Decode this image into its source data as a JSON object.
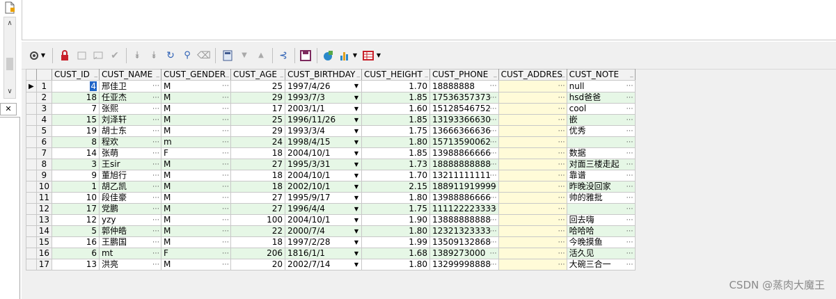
{
  "left_panel": {
    "icons": [
      "page-icon",
      "scroll-up-icon",
      "scroll-down-icon",
      "close-icon"
    ],
    "close_label": "✕"
  },
  "toolbar": {
    "buttons": [
      {
        "name": "grid-options-button",
        "icon": "gear-icon"
      },
      {
        "name": "lock-button",
        "icon": "lock-icon"
      },
      {
        "name": "insert-record-button",
        "icon": "insert-icon"
      },
      {
        "name": "delete-record-button",
        "icon": "delete-icon"
      },
      {
        "name": "post-changes-button",
        "icon": "check-icon"
      },
      {
        "name": "next-record-button",
        "icon": "arrow-down-icon"
      },
      {
        "name": "last-record-button",
        "icon": "arrow-down-end-icon"
      },
      {
        "name": "refresh-button",
        "icon": "refresh-icon"
      },
      {
        "name": "find-button",
        "icon": "binoculars-icon"
      },
      {
        "name": "clear-button",
        "icon": "eraser-icon"
      },
      {
        "name": "query-button",
        "icon": "calculator-icon"
      },
      {
        "name": "sort-desc-button",
        "icon": "triangle-down-icon"
      },
      {
        "name": "sort-asc-button",
        "icon": "triangle-up-icon"
      },
      {
        "name": "tree-button",
        "icon": "tree-icon"
      },
      {
        "name": "save-button",
        "icon": "save-icon"
      },
      {
        "name": "export-button",
        "icon": "export-icon"
      },
      {
        "name": "chart-button",
        "icon": "chart-icon"
      },
      {
        "name": "grid-view-button",
        "icon": "table-icon"
      }
    ]
  },
  "grid": {
    "columns": [
      "CUST_ID",
      "CUST_NAME",
      "CUST_GENDER",
      "CUST_AGE",
      "CUST_BIRTHDAY",
      "CUST_HEIGHT",
      "CUST_PHONE",
      "CUST_ADDRES",
      "CUST_NOTE"
    ],
    "rows": [
      {
        "rn": "1",
        "id": "4",
        "name": "邢佳卫",
        "gender": "M",
        "age": "25",
        "birthday": "1997/4/26",
        "height": "1.70",
        "phone": "18888888",
        "address": "",
        "note": "null"
      },
      {
        "rn": "2",
        "id": "18",
        "name": "任亚杰",
        "gender": "M",
        "age": "29",
        "birthday": "1993/7/3",
        "height": "1.85",
        "phone": "17536357373",
        "address": "",
        "note": "hsd爸爸"
      },
      {
        "rn": "3",
        "id": "7",
        "name": "张熙",
        "gender": "M",
        "age": "17",
        "birthday": "2003/1/1",
        "height": "1.60",
        "phone": "15128546752",
        "address": "",
        "note": "cool"
      },
      {
        "rn": "4",
        "id": "15",
        "name": "刘泽轩",
        "gender": "M",
        "age": "25",
        "birthday": "1996/11/26",
        "height": "1.85",
        "phone": "13193366630",
        "address": "",
        "note": "嵌"
      },
      {
        "rn": "5",
        "id": "19",
        "name": "胡士东",
        "gender": "M",
        "age": "29",
        "birthday": "1993/3/4",
        "height": "1.75",
        "phone": "13666366636",
        "address": "",
        "note": "优秀"
      },
      {
        "rn": "6",
        "id": "8",
        "name": "程欢",
        "gender": "m",
        "age": "24",
        "birthday": "1998/4/15",
        "height": "1.80",
        "phone": "15713590062",
        "address": "",
        "note": ""
      },
      {
        "rn": "7",
        "id": "14",
        "name": "张萌",
        "gender": "F",
        "age": "18",
        "birthday": "2004/10/1",
        "height": "1.85",
        "phone": "13988866666",
        "address": "",
        "note": "数据"
      },
      {
        "rn": "8",
        "id": "3",
        "name": "王sir",
        "gender": "M",
        "age": "27",
        "birthday": "1995/3/31",
        "height": "1.73",
        "phone": "18888888888",
        "address": "",
        "note": "对面三楼走起"
      },
      {
        "rn": "9",
        "id": "9",
        "name": "董旭行",
        "gender": "M",
        "age": "18",
        "birthday": "2004/10/1",
        "height": "1.70",
        "phone": "13211111111",
        "address": "",
        "note": "靠谱"
      },
      {
        "rn": "10",
        "id": "1",
        "name": "胡乙凯",
        "gender": "M",
        "age": "18",
        "birthday": "2002/10/1",
        "height": "2.15",
        "phone": "188911919999",
        "address": "",
        "note": "昨晚没回家"
      },
      {
        "rn": "11",
        "id": "10",
        "name": "段佳豪",
        "gender": "M",
        "age": "27",
        "birthday": "1995/9/17",
        "height": "1.80",
        "phone": "13988886666",
        "address": "",
        "note": "帅的雅批"
      },
      {
        "rn": "12",
        "id": "17",
        "name": "党鹏",
        "gender": "M",
        "age": "27",
        "birthday": "1996/4/4",
        "height": "1.75",
        "phone": "111122223333",
        "address": "",
        "note": ""
      },
      {
        "rn": "13",
        "id": "12",
        "name": "yzy",
        "gender": "M",
        "age": "100",
        "birthday": "2004/10/1",
        "height": "1.90",
        "phone": "13888888888",
        "address": "",
        "note": "回去嗨"
      },
      {
        "rn": "14",
        "id": "5",
        "name": "郭仲皓",
        "gender": "M",
        "age": "22",
        "birthday": "2000/7/4",
        "height": "1.80",
        "phone": "12321323333",
        "address": "",
        "note": "哈哈哈"
      },
      {
        "rn": "15",
        "id": "16",
        "name": "王鹏国",
        "gender": "M",
        "age": "18",
        "birthday": "1997/2/28",
        "height": "1.99",
        "phone": "13509132868",
        "address": "",
        "note": "今晚摸鱼"
      },
      {
        "rn": "16",
        "id": "6",
        "name": "mt",
        "gender": "F",
        "age": "206",
        "birthday": "1816/1/1",
        "height": "1.68",
        "phone": "1389273000",
        "address": "",
        "note": "活久见"
      },
      {
        "rn": "17",
        "id": "13",
        "name": "洪亮",
        "gender": "M",
        "age": "20",
        "birthday": "2002/7/14",
        "height": "1.80",
        "phone": "13299998888",
        "address": "",
        "note": "大碗三合一"
      }
    ]
  },
  "watermark": "CSDN @蒸肉大魔王",
  "colors": {
    "alt_row": "#e6f7e6",
    "address_cell": "#fffbd8",
    "selection": "#1e64c8"
  }
}
